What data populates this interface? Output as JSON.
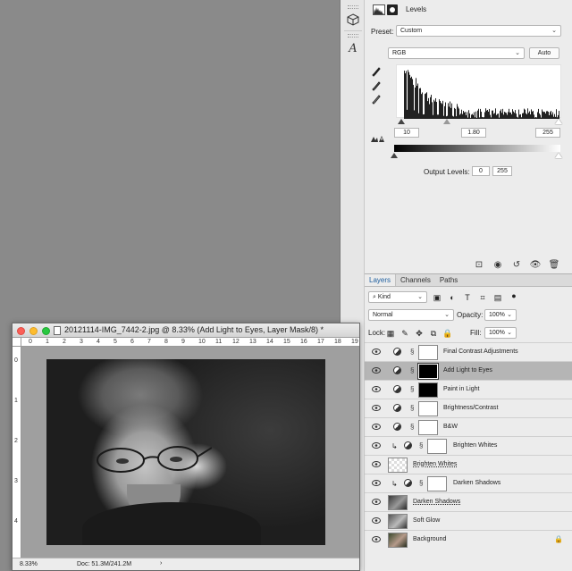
{
  "properties": {
    "title": "Levels",
    "preset_label": "Preset:",
    "preset_value": "Custom",
    "channel_value": "RGB",
    "auto_label": "Auto",
    "input_black": "10",
    "input_gamma": "1.80",
    "input_white": "255",
    "output_label": "Output Levels:",
    "output_black": "0",
    "output_white": "255"
  },
  "layers_panel": {
    "tabs": [
      "Layers",
      "Channels",
      "Paths"
    ],
    "kind_label": "Kind",
    "blend_mode": "Normal",
    "opacity_label": "Opacity:",
    "opacity_value": "100%",
    "lock_label": "Lock:",
    "fill_label": "Fill:",
    "fill_value": "100%",
    "layers": [
      {
        "name": "Final Contrast Adjustments"
      },
      {
        "name": "Add Light to Eyes"
      },
      {
        "name": "Paint in Light"
      },
      {
        "name": "Brightness/Contrast"
      },
      {
        "name": "B&W"
      },
      {
        "name": "Brighten Whites"
      },
      {
        "name": "Brighten Whites"
      },
      {
        "name": "Darken Shadows"
      },
      {
        "name": "Darken Shadows"
      },
      {
        "name": "Soft Glow"
      },
      {
        "name": "Background"
      }
    ]
  },
  "document": {
    "title": "20121114-IMG_7442-2.jpg @ 8.33% (Add Light to Eyes, Layer Mask/8) *",
    "zoom": "8.33%",
    "doc_size": "Doc: 51.3M/241.2M",
    "ruler_h": [
      "0",
      "1",
      "2",
      "3",
      "4",
      "5",
      "6",
      "7",
      "8",
      "9",
      "10",
      "11",
      "12",
      "13",
      "14",
      "15",
      "16",
      "17",
      "18",
      "19"
    ],
    "ruler_v": [
      "0",
      "1",
      "2",
      "3",
      "4"
    ]
  },
  "colors": {
    "panel_bg": "#ececec",
    "workspace_bg": "#8a8a8a",
    "selected_layer": "#b5b5b5",
    "tab_active": "#2060a0"
  },
  "icons": [
    "cube-3d-icon",
    "character-icon",
    "levels-icon",
    "mask-icon",
    "eyedropper-black-icon",
    "eyedropper-gray-icon",
    "eyedropper-white-icon",
    "clip-icon",
    "reset-icon",
    "eye-icon",
    "trash-icon",
    "lock-icon",
    "link-icon"
  ]
}
